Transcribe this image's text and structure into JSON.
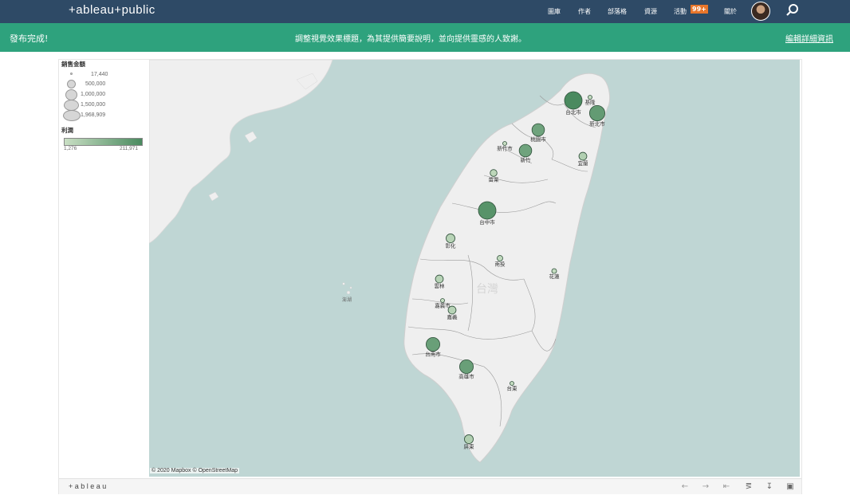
{
  "topbar": {
    "logo": "+ableau+public",
    "nav": [
      "圖庫",
      "作者",
      "部落格",
      "資源",
      "活動",
      "關於"
    ],
    "badge": "99+"
  },
  "banner": {
    "title": "發布完成!",
    "message": "調整視覺效果標題，為其提供簡要說明，並向提供靈感的人致謝。",
    "link": "編輯詳細資訊"
  },
  "legend": {
    "size_title": "銷售金額",
    "size_values": [
      "17,440",
      "500,000",
      "1,000,000",
      "1,500,000",
      "1,968,909"
    ],
    "color_title": "利潤",
    "color_min": "1,276",
    "color_max": "211,971"
  },
  "map": {
    "attribution": "© 2020 Mapbox © OpenStreetMap",
    "island_label": "台灣",
    "penghu_label": "澎湖",
    "colors": {
      "sea": "#bfd6d4",
      "land": "#efefef",
      "bubble_dark": "#4a8a5f",
      "bubble_light": "#b7d3ab"
    },
    "cities": [
      {
        "name": "台北市",
        "sales": 1968909,
        "profit": 211971
      },
      {
        "name": "基隆",
        "sales": 60000,
        "profit": 8000
      },
      {
        "name": "新北市",
        "sales": 1500000,
        "profit": 170000
      },
      {
        "name": "桃園市",
        "sales": 1000000,
        "profit": 150000
      },
      {
        "name": "新竹市",
        "sales": 30000,
        "profit": 4000
      },
      {
        "name": "新竹",
        "sales": 1000000,
        "profit": 150000
      },
      {
        "name": "宜蘭",
        "sales": 400000,
        "profit": 40000
      },
      {
        "name": "苗栗",
        "sales": 300000,
        "profit": 20000
      },
      {
        "name": "台中市",
        "sales": 1968909,
        "profit": 190000
      },
      {
        "name": "彰化",
        "sales": 500000,
        "profit": 30000
      },
      {
        "name": "南投",
        "sales": 200000,
        "profit": 15000
      },
      {
        "name": "花蓮",
        "sales": 150000,
        "profit": 10000
      },
      {
        "name": "雲林",
        "sales": 400000,
        "profit": 30000
      },
      {
        "name": "嘉義市",
        "sales": 30000,
        "profit": 3000
      },
      {
        "name": "嘉義",
        "sales": 400000,
        "profit": 30000
      },
      {
        "name": "台南市",
        "sales": 1200000,
        "profit": 160000
      },
      {
        "name": "高雄市",
        "sales": 1200000,
        "profit": 160000
      },
      {
        "name": "台東",
        "sales": 100000,
        "profit": 8000
      },
      {
        "name": "屏東",
        "sales": 500000,
        "profit": 40000
      }
    ]
  },
  "toolbar": {
    "logo": "+ableau",
    "buttons": [
      "undo-icon",
      "redo-icon",
      "revert-icon",
      "share-icon",
      "download-icon",
      "fullscreen-icon"
    ]
  }
}
